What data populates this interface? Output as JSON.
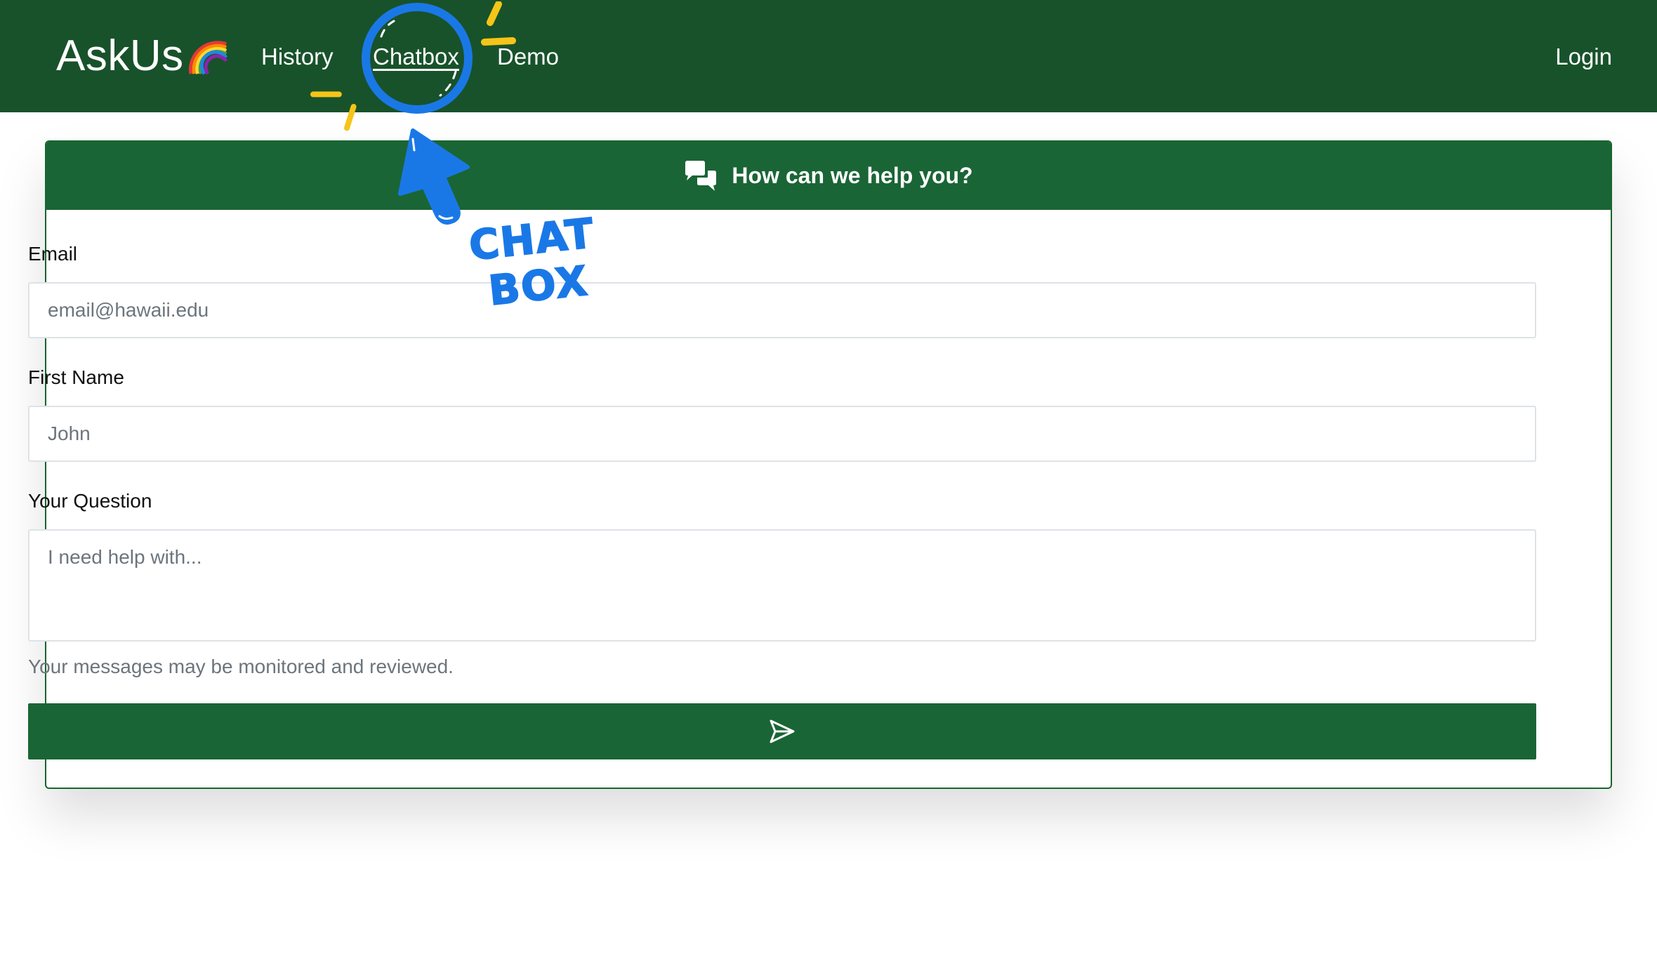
{
  "navbar": {
    "brand": "AskUs",
    "brand_emoji": "rainbow-emoji",
    "links": [
      {
        "label": "History"
      },
      {
        "label": "Chatbox",
        "active": true
      },
      {
        "label": "Demo"
      }
    ],
    "login_label": "Login",
    "background_color": "#18522b"
  },
  "card": {
    "header_title": "How can we help you?",
    "header_icon": "chat-bubbles-icon",
    "accent_color": "#1a6535",
    "fields": {
      "email": {
        "label": "Email",
        "placeholder": "email@hawaii.edu"
      },
      "first_name": {
        "label": "First Name",
        "placeholder": "John"
      },
      "question": {
        "label": "Your Question",
        "placeholder": "I need help with..."
      }
    },
    "helper_text": "Your messages may be monitored and reviewed.",
    "submit_icon": "send-icon"
  },
  "annotation": {
    "words": [
      "CHAT",
      "BOX"
    ],
    "color": "#1a78e6",
    "highlight_color": "#f5c518"
  }
}
